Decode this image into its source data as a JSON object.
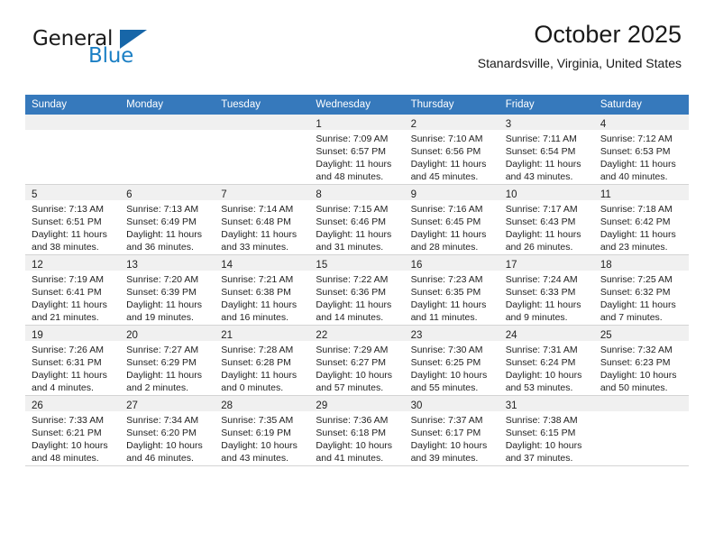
{
  "brand": {
    "name_top": "General",
    "name_bottom": "Blue",
    "triangle_color": "#1766a8",
    "blue_color": "#1b7fc4"
  },
  "header": {
    "title": "October 2025",
    "subtitle": "Stanardsville, Virginia, United States"
  },
  "theme": {
    "header_row_bg": "#3679bc",
    "header_row_text": "#ffffff",
    "daynum_bar_bg": "#f0f0f0",
    "row_divider": "#d4d4d4"
  },
  "weekday_headers": [
    "Sunday",
    "Monday",
    "Tuesday",
    "Wednesday",
    "Thursday",
    "Friday",
    "Saturday"
  ],
  "labels": {
    "sunrise_prefix": "Sunrise:",
    "sunset_prefix": "Sunset:",
    "daylight_prefix": "Daylight:"
  },
  "weeks": [
    [
      {
        "empty": true
      },
      {
        "empty": true
      },
      {
        "empty": true
      },
      {
        "empty": false,
        "day": "1",
        "sunrise": "Sunrise: 7:09 AM",
        "sunset": "Sunset: 6:57 PM",
        "daylight_1": "Daylight: 11 hours",
        "daylight_2": "and 48 minutes."
      },
      {
        "empty": false,
        "day": "2",
        "sunrise": "Sunrise: 7:10 AM",
        "sunset": "Sunset: 6:56 PM",
        "daylight_1": "Daylight: 11 hours",
        "daylight_2": "and 45 minutes."
      },
      {
        "empty": false,
        "day": "3",
        "sunrise": "Sunrise: 7:11 AM",
        "sunset": "Sunset: 6:54 PM",
        "daylight_1": "Daylight: 11 hours",
        "daylight_2": "and 43 minutes."
      },
      {
        "empty": false,
        "day": "4",
        "sunrise": "Sunrise: 7:12 AM",
        "sunset": "Sunset: 6:53 PM",
        "daylight_1": "Daylight: 11 hours",
        "daylight_2": "and 40 minutes."
      }
    ],
    [
      {
        "empty": false,
        "day": "5",
        "sunrise": "Sunrise: 7:13 AM",
        "sunset": "Sunset: 6:51 PM",
        "daylight_1": "Daylight: 11 hours",
        "daylight_2": "and 38 minutes."
      },
      {
        "empty": false,
        "day": "6",
        "sunrise": "Sunrise: 7:13 AM",
        "sunset": "Sunset: 6:49 PM",
        "daylight_1": "Daylight: 11 hours",
        "daylight_2": "and 36 minutes."
      },
      {
        "empty": false,
        "day": "7",
        "sunrise": "Sunrise: 7:14 AM",
        "sunset": "Sunset: 6:48 PM",
        "daylight_1": "Daylight: 11 hours",
        "daylight_2": "and 33 minutes."
      },
      {
        "empty": false,
        "day": "8",
        "sunrise": "Sunrise: 7:15 AM",
        "sunset": "Sunset: 6:46 PM",
        "daylight_1": "Daylight: 11 hours",
        "daylight_2": "and 31 minutes."
      },
      {
        "empty": false,
        "day": "9",
        "sunrise": "Sunrise: 7:16 AM",
        "sunset": "Sunset: 6:45 PM",
        "daylight_1": "Daylight: 11 hours",
        "daylight_2": "and 28 minutes."
      },
      {
        "empty": false,
        "day": "10",
        "sunrise": "Sunrise: 7:17 AM",
        "sunset": "Sunset: 6:43 PM",
        "daylight_1": "Daylight: 11 hours",
        "daylight_2": "and 26 minutes."
      },
      {
        "empty": false,
        "day": "11",
        "sunrise": "Sunrise: 7:18 AM",
        "sunset": "Sunset: 6:42 PM",
        "daylight_1": "Daylight: 11 hours",
        "daylight_2": "and 23 minutes."
      }
    ],
    [
      {
        "empty": false,
        "day": "12",
        "sunrise": "Sunrise: 7:19 AM",
        "sunset": "Sunset: 6:41 PM",
        "daylight_1": "Daylight: 11 hours",
        "daylight_2": "and 21 minutes."
      },
      {
        "empty": false,
        "day": "13",
        "sunrise": "Sunrise: 7:20 AM",
        "sunset": "Sunset: 6:39 PM",
        "daylight_1": "Daylight: 11 hours",
        "daylight_2": "and 19 minutes."
      },
      {
        "empty": false,
        "day": "14",
        "sunrise": "Sunrise: 7:21 AM",
        "sunset": "Sunset: 6:38 PM",
        "daylight_1": "Daylight: 11 hours",
        "daylight_2": "and 16 minutes."
      },
      {
        "empty": false,
        "day": "15",
        "sunrise": "Sunrise: 7:22 AM",
        "sunset": "Sunset: 6:36 PM",
        "daylight_1": "Daylight: 11 hours",
        "daylight_2": "and 14 minutes."
      },
      {
        "empty": false,
        "day": "16",
        "sunrise": "Sunrise: 7:23 AM",
        "sunset": "Sunset: 6:35 PM",
        "daylight_1": "Daylight: 11 hours",
        "daylight_2": "and 11 minutes."
      },
      {
        "empty": false,
        "day": "17",
        "sunrise": "Sunrise: 7:24 AM",
        "sunset": "Sunset: 6:33 PM",
        "daylight_1": "Daylight: 11 hours",
        "daylight_2": "and 9 minutes."
      },
      {
        "empty": false,
        "day": "18",
        "sunrise": "Sunrise: 7:25 AM",
        "sunset": "Sunset: 6:32 PM",
        "daylight_1": "Daylight: 11 hours",
        "daylight_2": "and 7 minutes."
      }
    ],
    [
      {
        "empty": false,
        "day": "19",
        "sunrise": "Sunrise: 7:26 AM",
        "sunset": "Sunset: 6:31 PM",
        "daylight_1": "Daylight: 11 hours",
        "daylight_2": "and 4 minutes."
      },
      {
        "empty": false,
        "day": "20",
        "sunrise": "Sunrise: 7:27 AM",
        "sunset": "Sunset: 6:29 PM",
        "daylight_1": "Daylight: 11 hours",
        "daylight_2": "and 2 minutes."
      },
      {
        "empty": false,
        "day": "21",
        "sunrise": "Sunrise: 7:28 AM",
        "sunset": "Sunset: 6:28 PM",
        "daylight_1": "Daylight: 11 hours",
        "daylight_2": "and 0 minutes."
      },
      {
        "empty": false,
        "day": "22",
        "sunrise": "Sunrise: 7:29 AM",
        "sunset": "Sunset: 6:27 PM",
        "daylight_1": "Daylight: 10 hours",
        "daylight_2": "and 57 minutes."
      },
      {
        "empty": false,
        "day": "23",
        "sunrise": "Sunrise: 7:30 AM",
        "sunset": "Sunset: 6:25 PM",
        "daylight_1": "Daylight: 10 hours",
        "daylight_2": "and 55 minutes."
      },
      {
        "empty": false,
        "day": "24",
        "sunrise": "Sunrise: 7:31 AM",
        "sunset": "Sunset: 6:24 PM",
        "daylight_1": "Daylight: 10 hours",
        "daylight_2": "and 53 minutes."
      },
      {
        "empty": false,
        "day": "25",
        "sunrise": "Sunrise: 7:32 AM",
        "sunset": "Sunset: 6:23 PM",
        "daylight_1": "Daylight: 10 hours",
        "daylight_2": "and 50 minutes."
      }
    ],
    [
      {
        "empty": false,
        "day": "26",
        "sunrise": "Sunrise: 7:33 AM",
        "sunset": "Sunset: 6:21 PM",
        "daylight_1": "Daylight: 10 hours",
        "daylight_2": "and 48 minutes."
      },
      {
        "empty": false,
        "day": "27",
        "sunrise": "Sunrise: 7:34 AM",
        "sunset": "Sunset: 6:20 PM",
        "daylight_1": "Daylight: 10 hours",
        "daylight_2": "and 46 minutes."
      },
      {
        "empty": false,
        "day": "28",
        "sunrise": "Sunrise: 7:35 AM",
        "sunset": "Sunset: 6:19 PM",
        "daylight_1": "Daylight: 10 hours",
        "daylight_2": "and 43 minutes."
      },
      {
        "empty": false,
        "day": "29",
        "sunrise": "Sunrise: 7:36 AM",
        "sunset": "Sunset: 6:18 PM",
        "daylight_1": "Daylight: 10 hours",
        "daylight_2": "and 41 minutes."
      },
      {
        "empty": false,
        "day": "30",
        "sunrise": "Sunrise: 7:37 AM",
        "sunset": "Sunset: 6:17 PM",
        "daylight_1": "Daylight: 10 hours",
        "daylight_2": "and 39 minutes."
      },
      {
        "empty": false,
        "day": "31",
        "sunrise": "Sunrise: 7:38 AM",
        "sunset": "Sunset: 6:15 PM",
        "daylight_1": "Daylight: 10 hours",
        "daylight_2": "and 37 minutes."
      },
      {
        "empty": true
      }
    ]
  ]
}
